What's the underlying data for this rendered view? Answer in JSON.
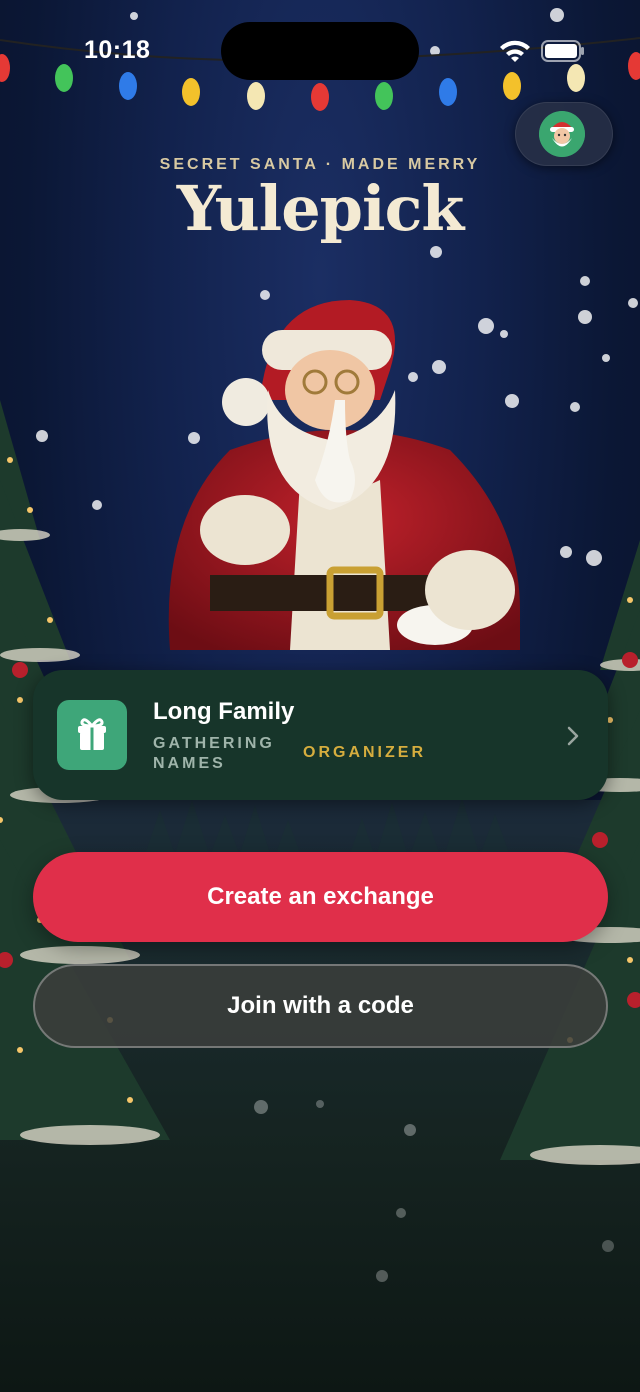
{
  "status_bar": {
    "time": "10:18"
  },
  "header": {
    "tagline": "SECRET SANTA · MADE MERRY",
    "app_title": "Yulepick",
    "profile_icon": "santa-avatar-icon"
  },
  "exchange_card": {
    "name": "Long Family",
    "status": "GATHERING NAMES",
    "role": "ORGANIZER",
    "icon": "gift-icon",
    "chevron": "chevron-right-icon"
  },
  "actions": {
    "create_label": "Create an exchange",
    "join_label": "Join with a code"
  },
  "colors": {
    "primary": "#e02f4a",
    "card_bg": "#17352a",
    "accent_gold": "#d6ad3e",
    "icon_green": "#3ea679"
  }
}
